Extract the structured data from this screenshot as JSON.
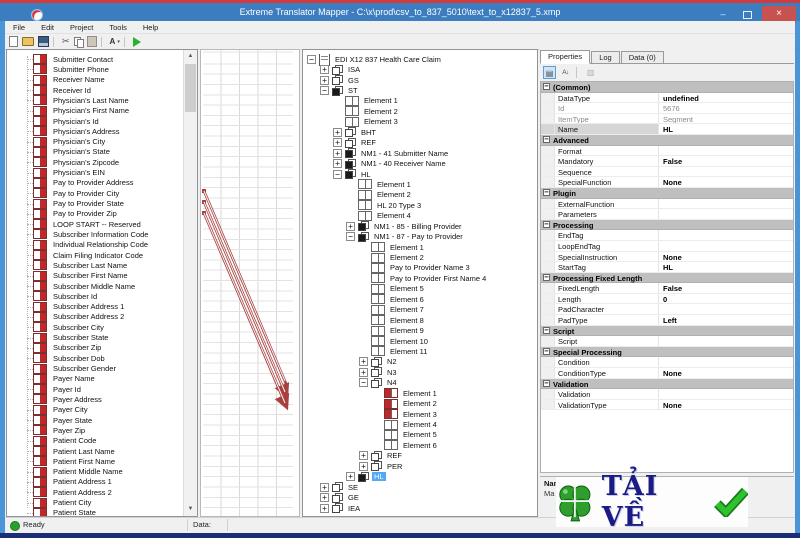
{
  "window": {
    "title": "Extreme Translator Mapper - C:\\x\\prod\\csv_to_837_5010\\text_to_x12837_5.xmp",
    "close_glyph": "×",
    "minimize_glyph": "–"
  },
  "menu": {
    "items": [
      "File",
      "Edit",
      "Project",
      "Tools",
      "Help"
    ]
  },
  "toolbar": {
    "icons": [
      "new-file",
      "open-file",
      "save-file",
      "cut",
      "copy",
      "paste",
      "font-map-tool",
      "run"
    ]
  },
  "left_tree": {
    "items": [
      "Submitter Contact",
      "Submitter Phone",
      "Receiver Name",
      "Receiver Id",
      "Physician's Last Name",
      "Physician's First Name",
      "Physician's Id",
      "Physician's Address",
      "Physician's City",
      "Physician's State",
      "Physician's Zipcode",
      "Physician's EIN",
      "Pay to Provider Address",
      "Pay to Provider City",
      "Pay to Provider State",
      "Pay to Provider Zip",
      "LOOP START -- Reserved",
      "Subscriber Information Code",
      "Individual Relationship Code",
      "Claim Filing Indicator Code",
      "Subscriber Last Name",
      "Subscriber First Name",
      "Subscriber Middle Name",
      "Subscriber Id",
      "Subscriber Address 1",
      "Subscriber Address 2",
      "Subscriber City",
      "Subscriber State",
      "Subscriber Zip",
      "Subscriber Dob",
      "Subscriber Gender",
      "Payer Name",
      "Payer Id",
      "Payer Address",
      "Payer City",
      "Payer State",
      "Payer Zip",
      "Patient Code",
      "Patient Last Name",
      "Patient First Name",
      "Patient Middle Name",
      "Patient Address 1",
      "Patient Address 2",
      "Patient City",
      "Patient State"
    ]
  },
  "edi_tree": {
    "items": [
      {
        "t": "EDI X12 837 Health Care Claim",
        "d": 0,
        "ic": "root",
        "ex": "-"
      },
      {
        "t": "ISA",
        "d": 1,
        "ic": "seg",
        "ex": "+"
      },
      {
        "t": "GS",
        "d": 1,
        "ic": "seg",
        "ex": "+"
      },
      {
        "t": "ST",
        "d": 1,
        "ic": "sega",
        "ex": "-"
      },
      {
        "t": "Element 1",
        "d": 2,
        "ic": "el"
      },
      {
        "t": "Element 2",
        "d": 2,
        "ic": "el"
      },
      {
        "t": "Element 3",
        "d": 2,
        "ic": "el"
      },
      {
        "t": "BHT",
        "d": 2,
        "ic": "seg",
        "ex": "+"
      },
      {
        "t": "REF",
        "d": 2,
        "ic": "seg",
        "ex": "+"
      },
      {
        "t": "NM1 - 41 Submitter Name",
        "d": 2,
        "ic": "sega",
        "ex": "+"
      },
      {
        "t": "NM1 - 40 Receiver Name",
        "d": 2,
        "ic": "sega",
        "ex": "+"
      },
      {
        "t": "HL",
        "d": 2,
        "ic": "sega",
        "ex": "-"
      },
      {
        "t": "Element 1",
        "d": 3,
        "ic": "el"
      },
      {
        "t": "Element 2",
        "d": 3,
        "ic": "el"
      },
      {
        "t": "HL 20 Type 3",
        "d": 3,
        "ic": "el"
      },
      {
        "t": "Element 4",
        "d": 3,
        "ic": "el"
      },
      {
        "t": "NM1 - 85 - Billing Provider",
        "d": 3,
        "ic": "sega",
        "ex": "+"
      },
      {
        "t": "NM1 - 87 - Pay to Provider",
        "d": 3,
        "ic": "sega",
        "ex": "-"
      },
      {
        "t": "Element 1",
        "d": 4,
        "ic": "el"
      },
      {
        "t": "Element 2",
        "d": 4,
        "ic": "el"
      },
      {
        "t": "Pay to Provider Name 3",
        "d": 4,
        "ic": "el"
      },
      {
        "t": "Pay to Provider First Name 4",
        "d": 4,
        "ic": "el"
      },
      {
        "t": "Element 5",
        "d": 4,
        "ic": "el"
      },
      {
        "t": "Element 6",
        "d": 4,
        "ic": "el"
      },
      {
        "t": "Element 7",
        "d": 4,
        "ic": "el"
      },
      {
        "t": "Element 8",
        "d": 4,
        "ic": "el"
      },
      {
        "t": "Element 9",
        "d": 4,
        "ic": "el"
      },
      {
        "t": "Element 10",
        "d": 4,
        "ic": "el"
      },
      {
        "t": "Element 11",
        "d": 4,
        "ic": "el"
      },
      {
        "t": "N2",
        "d": 4,
        "ic": "seg",
        "ex": "+"
      },
      {
        "t": "N3",
        "d": 4,
        "ic": "seg",
        "ex": "+"
      },
      {
        "t": "N4",
        "d": 4,
        "ic": "seg",
        "ex": "-"
      },
      {
        "t": "Element 1",
        "d": 5,
        "ic": "elr"
      },
      {
        "t": "Element 2",
        "d": 5,
        "ic": "elr"
      },
      {
        "t": "Element 3",
        "d": 5,
        "ic": "elr"
      },
      {
        "t": "Element 4",
        "d": 5,
        "ic": "el"
      },
      {
        "t": "Element 5",
        "d": 5,
        "ic": "el"
      },
      {
        "t": "Element 6",
        "d": 5,
        "ic": "el"
      },
      {
        "t": "REF",
        "d": 4,
        "ic": "seg",
        "ex": "+"
      },
      {
        "t": "PER",
        "d": 4,
        "ic": "seg",
        "ex": "+"
      },
      {
        "t": "HL",
        "d": 3,
        "ic": "sega",
        "ex": "+",
        "sel": true
      },
      {
        "t": "SE",
        "d": 1,
        "ic": "seg",
        "ex": "+"
      },
      {
        "t": "GE",
        "d": 1,
        "ic": "seg",
        "ex": "+"
      },
      {
        "t": "IEA",
        "d": 1,
        "ic": "seg",
        "ex": "+"
      }
    ]
  },
  "mapping": {
    "line_count": 3,
    "color": "#a84040"
  },
  "properties": {
    "tabs": [
      "Properties",
      "Log",
      "Data (0)"
    ],
    "rows": [
      {
        "cat": true,
        "name": "(Common)"
      },
      {
        "name": "DataType",
        "value": "undefined"
      },
      {
        "name": "Id",
        "value": "5676",
        "dis": true
      },
      {
        "name": "ItemType",
        "value": "Segment",
        "dis": true
      },
      {
        "name": "Name",
        "value": "HL",
        "sel": true
      },
      {
        "cat": true,
        "name": "Advanced"
      },
      {
        "name": "Format",
        "value": ""
      },
      {
        "name": "Mandatory",
        "value": "False"
      },
      {
        "name": "Sequence",
        "value": ""
      },
      {
        "name": "SpecialFunction",
        "value": "None"
      },
      {
        "cat": true,
        "name": "Plugin"
      },
      {
        "name": "ExternalFunction",
        "value": ""
      },
      {
        "name": "Parameters",
        "value": ""
      },
      {
        "cat": true,
        "name": "Processing"
      },
      {
        "name": "EndTag",
        "value": ""
      },
      {
        "name": "LoopEndTag",
        "value": ""
      },
      {
        "name": "SpecialInstruction",
        "value": "None"
      },
      {
        "name": "StartTag",
        "value": "HL"
      },
      {
        "cat": true,
        "name": "Processing Fixed Length"
      },
      {
        "name": "FixedLength",
        "value": "False"
      },
      {
        "name": "Length",
        "value": "0"
      },
      {
        "name": "PadCharacter",
        "value": ""
      },
      {
        "name": "PadType",
        "value": "Left"
      },
      {
        "cat": true,
        "name": "Script"
      },
      {
        "name": "Script",
        "value": ""
      },
      {
        "cat": true,
        "name": "Special Processing"
      },
      {
        "name": "Condition",
        "value": ""
      },
      {
        "name": "ConditionType",
        "value": "None"
      },
      {
        "cat": true,
        "name": "Validation"
      },
      {
        "name": "Validation",
        "value": ""
      },
      {
        "name": "ValidationType",
        "value": "None"
      }
    ]
  },
  "description": {
    "title": "Name",
    "text": "Ma"
  },
  "status_bar": {
    "ready": "Ready",
    "data_label": "Data:"
  },
  "watermark": {
    "text": "TẢI VỀ"
  },
  "colors": {
    "titlebar": "#3c7dc0",
    "close_button": "#c85250",
    "top_border": "#d23b3b",
    "side_border": "#4a94d8",
    "bottom_border": "#1c2d78",
    "map_line": "#a84040",
    "mapped_icon": "#c22626",
    "selection": "#55a8f5",
    "status_green": "#2ca02c",
    "watermark_text": "#1b1b85",
    "watermark_green": "#2f9e2f"
  }
}
